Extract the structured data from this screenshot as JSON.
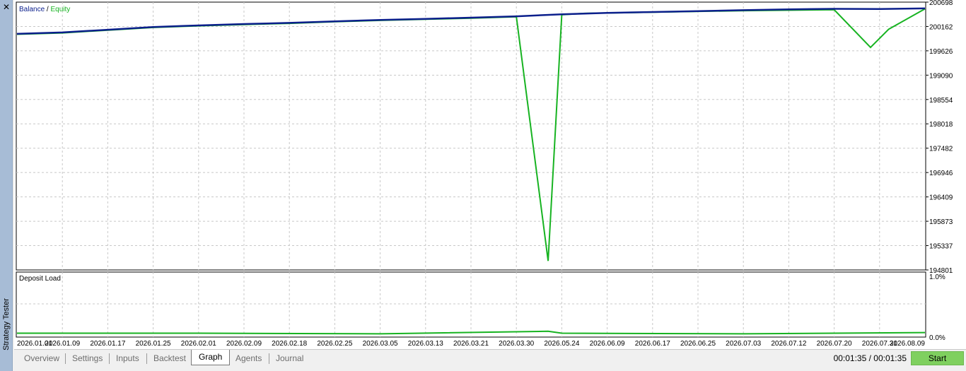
{
  "window": {
    "title": "Strategy Tester",
    "close_glyph": "✕"
  },
  "legend": {
    "balance_label": "Balance",
    "separator": " / ",
    "equity_label": "Equity",
    "balance_color": "#0b1f8c",
    "equity_color": "#17b321"
  },
  "deposit": {
    "title": "Deposit Load",
    "ticks": [
      "1.0%",
      "0.0%"
    ]
  },
  "tabs": [
    {
      "label": "Overview",
      "active": false
    },
    {
      "label": "Settings",
      "active": false
    },
    {
      "label": "Inputs",
      "active": false
    },
    {
      "label": "Backtest",
      "active": false
    },
    {
      "label": "Graph",
      "active": true
    },
    {
      "label": "Agents",
      "active": false
    },
    {
      "label": "Journal",
      "active": false
    }
  ],
  "status": {
    "timer": "00:01:35 / 00:01:35",
    "start_label": "Start",
    "start_color": "#7fd05f"
  },
  "chart_data": {
    "type": "line",
    "title": "",
    "xlabel": "",
    "ylabel": "",
    "ylim": [
      194801,
      200698
    ],
    "y_ticks": [
      200698,
      200162,
      199626,
      199090,
      198554,
      198018,
      197482,
      196946,
      196409,
      195873,
      195337,
      194801
    ],
    "x_ticks": [
      "2026.01.01",
      "2026.01.09",
      "2026.01.17",
      "2026.01.25",
      "2026.02.01",
      "2026.02.09",
      "2026.02.18",
      "2026.02.25",
      "2026.03.05",
      "2026.03.13",
      "2026.03.21",
      "2026.03.30",
      "2026.05.24",
      "2026.06.09",
      "2026.06.17",
      "2026.06.25",
      "2026.07.03",
      "2026.07.12",
      "2026.07.20",
      "2026.07.31",
      "2026.08.09"
    ],
    "grid": true,
    "legend": "top-left",
    "series": [
      {
        "name": "Balance",
        "x": [
          0,
          1,
          2,
          3,
          4,
          5,
          6,
          7,
          8,
          9,
          10,
          11,
          12,
          13,
          14,
          15,
          16,
          17,
          18,
          19,
          20
        ],
        "values": [
          200000,
          200030,
          200090,
          200150,
          200185,
          200215,
          200240,
          200275,
          200305,
          200330,
          200355,
          200385,
          200430,
          200460,
          200480,
          200500,
          200520,
          200540,
          200550,
          200545,
          200560
        ]
      },
      {
        "name": "Equity",
        "x": [
          0,
          1,
          2,
          3,
          4,
          5,
          6,
          7,
          8,
          9,
          10,
          11,
          11.7,
          12,
          12.5,
          16,
          18,
          18.8,
          19.2,
          20
        ],
        "values": [
          199990,
          200020,
          200080,
          200140,
          200175,
          200205,
          200230,
          200265,
          200295,
          200320,
          200345,
          200375,
          195000,
          200420,
          200450,
          200510,
          200530,
          199700,
          200100,
          200550
        ]
      },
      {
        "name": "Deposit Load",
        "x": [
          0,
          4,
          8,
          11.7,
          12,
          16,
          20
        ],
        "values": [
          0.05,
          0.05,
          0.04,
          0.08,
          0.05,
          0.04,
          0.06
        ]
      }
    ]
  }
}
